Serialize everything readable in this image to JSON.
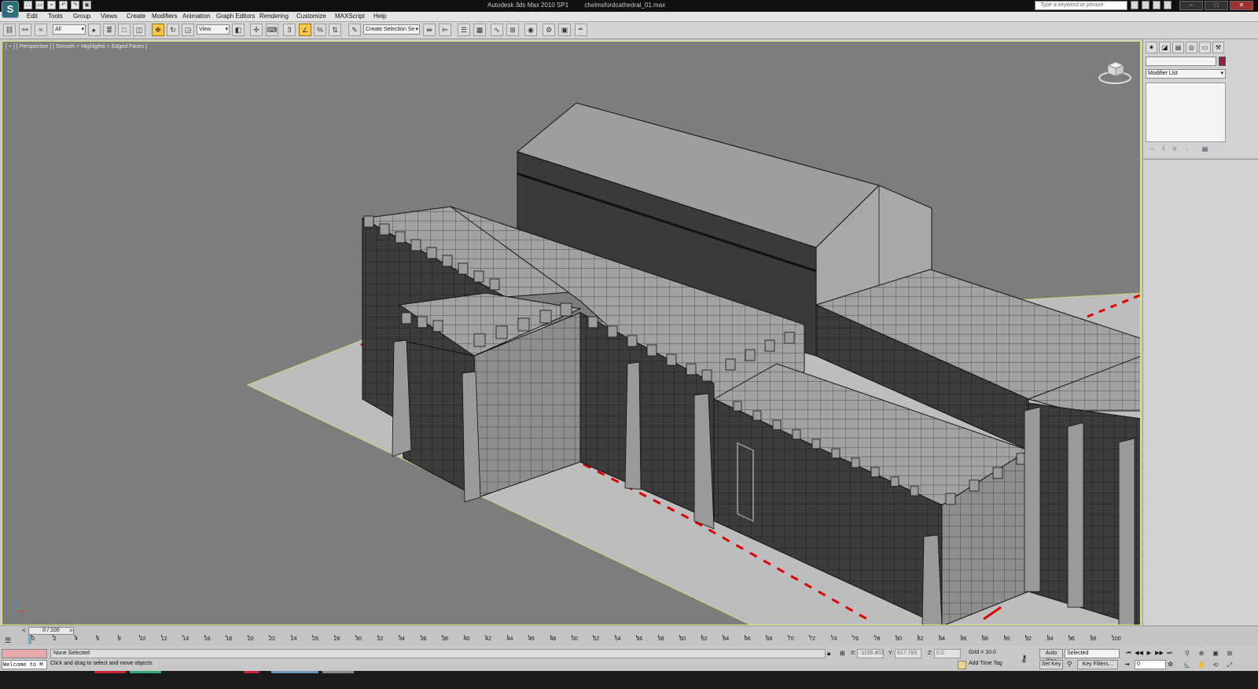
{
  "app": {
    "title": "Autodesk 3ds Max 2010 SP1",
    "file": "chelmsfordcathedral_01.max",
    "logo": "S"
  },
  "search": {
    "placeholder": "Type a keyword or phrase"
  },
  "menu": [
    "Edit",
    "Tools",
    "Group",
    "Views",
    "Create",
    "Modifiers",
    "Animation",
    "Graph Editors",
    "Rendering",
    "Customize",
    "MAXScript",
    "Help"
  ],
  "toolbar": {
    "filter_value": "All",
    "ref_coord_value": "View",
    "selection_set_value": "Create Selection Se"
  },
  "viewport": {
    "label": "[ + ] [ Perspective ] [ Smooth + Highlights + Edged Faces ]"
  },
  "command_panel": {
    "modifier_list": "Modifier List",
    "object_color": "#9c1d3a"
  },
  "timeline": {
    "slider": "0 / 100",
    "ticks": [
      "0",
      "2",
      "4",
      "6",
      "8",
      "10",
      "12",
      "14",
      "16",
      "18",
      "20",
      "22",
      "24",
      "26",
      "28",
      "30",
      "32",
      "34",
      "36",
      "38",
      "40",
      "42",
      "44",
      "46",
      "48",
      "50",
      "52",
      "54",
      "56",
      "58",
      "60",
      "62",
      "64",
      "66",
      "68",
      "70",
      "72",
      "74",
      "76",
      "78",
      "80",
      "82",
      "84",
      "86",
      "88",
      "90",
      "92",
      "94",
      "96",
      "98",
      "100"
    ]
  },
  "status": {
    "maxscript_listener": "",
    "welcome": "Welcome to M",
    "selection": "None Selected",
    "hint": "Click and drag to select and move objects",
    "x_label": "X:",
    "x_value": "-1155.403",
    "y_label": "Y:",
    "y_value": "617.783",
    "z_label": "Z:",
    "z_value": "0.0",
    "grid": "Grid = 10.0",
    "add_time_tag": "Add Time Tag",
    "auto_key": "Auto Key",
    "set_key": "Set Key",
    "key_mode": "Selected",
    "key_filters": "Key Filters...",
    "frame": "0"
  }
}
